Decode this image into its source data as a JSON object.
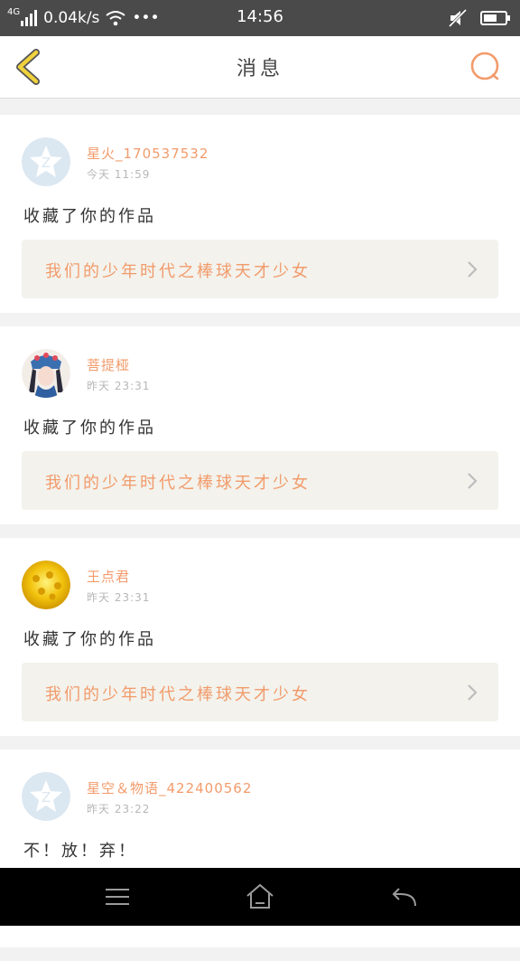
{
  "status_bar": {
    "network_type": "4G",
    "speed": "0.04k/s",
    "more": "•••",
    "time": "14:56"
  },
  "header": {
    "title": "消息"
  },
  "messages": [
    {
      "username": "星火_170537532",
      "time": "今天 11:59",
      "action": "收藏了你的作品",
      "work_title": "我们的少年时代之棒球天才少女",
      "avatar": "default-avatar"
    },
    {
      "username": "菩提桠",
      "time": "昨天 23:31",
      "action": "收藏了你的作品",
      "work_title": "我们的少年时代之棒球天才少女",
      "avatar": "opera-photo-avatar"
    },
    {
      "username": "王点君",
      "time": "昨天 23:31",
      "action": "收藏了你的作品",
      "work_title": "我们的少年时代之棒球天才少女",
      "avatar": "sunflower-photo-avatar"
    },
    {
      "username": "星空＆物语_422400562",
      "time": "昨天 23:22",
      "action": "不！放！弃！",
      "avatar": "default-avatar"
    }
  ],
  "colors": {
    "accent": "#f29b6b",
    "status_bar": "#4a4a4a",
    "back_icon": "#f0d23c",
    "work_box": "#f3f2ec",
    "default_avatar": "#dbe7f1"
  },
  "icons": {
    "back": "back-arrow-icon",
    "search": "search-icon",
    "nav_menu": "menu-icon",
    "nav_home": "home-icon",
    "nav_back": "back-nav-icon"
  }
}
